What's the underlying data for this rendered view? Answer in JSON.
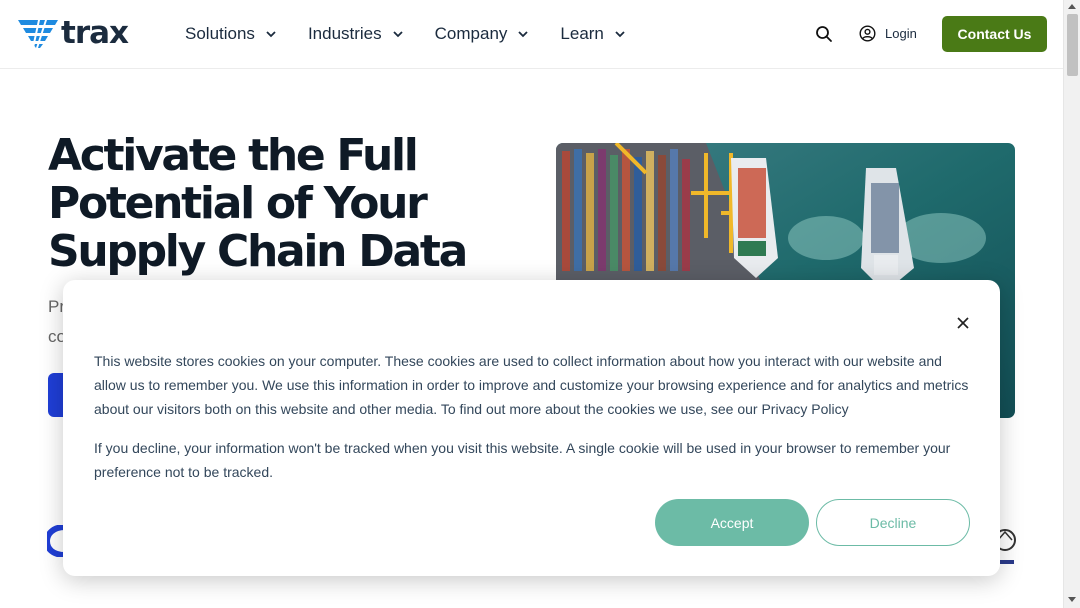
{
  "header": {
    "logo_text": "trax",
    "nav": [
      {
        "label": "Solutions"
      },
      {
        "label": "Industries"
      },
      {
        "label": "Company"
      },
      {
        "label": "Learn"
      }
    ],
    "login_label": "Login",
    "contact_label": "Contact Us"
  },
  "hero": {
    "title_lines": [
      "Activate the Full",
      "Potential of Your",
      "Supply Chain Data"
    ],
    "sub_peek_1": "Pr",
    "sub_peek_2": "co"
  },
  "cookie": {
    "paragraph1": "This website stores cookies on your computer. These cookies are used to collect information about how you interact with our website and allow us to remember you. We use this information in order to improve and customize your browsing experience and for analytics and metrics about our visitors both on this website and other media. To find out more about the cookies we use, see our Privacy Policy",
    "paragraph2": "If you decline, your information won't be tracked when you visit this website. A single cookie will be used in your browser to remember your preference not to be tracked.",
    "accept_label": "Accept",
    "decline_label": "Decline"
  },
  "colors": {
    "brand_blue": "#1f8be0",
    "brand_green": "#4a7a16",
    "accent_teal": "#6cbba6",
    "title_navy": "#0f1a26"
  },
  "icons": [
    "trax-logo-icon",
    "chevron-down-icon",
    "search-icon",
    "user-circle-icon",
    "close-icon"
  ]
}
